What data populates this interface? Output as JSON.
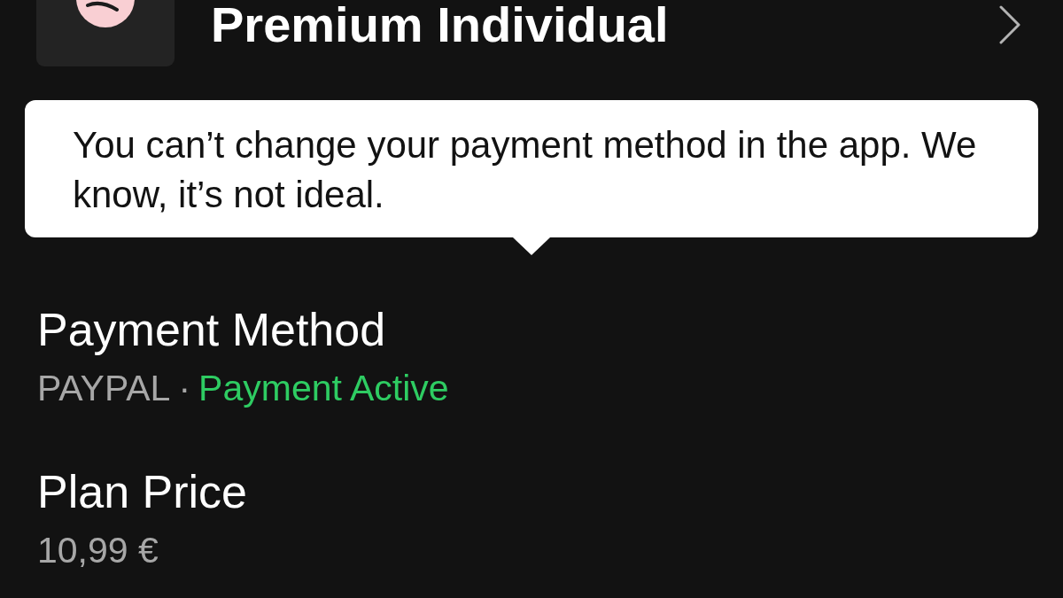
{
  "plan": {
    "title": "Premium Individual"
  },
  "tooltip": {
    "text": "You can’t change your payment method in the app. We know, it’s not ideal."
  },
  "details": [
    {
      "label": "Payment Method",
      "value": "PAYPAL",
      "separator": "·",
      "status": "Payment Active"
    },
    {
      "label": "Plan Price",
      "value": "10,99 €"
    }
  ]
}
